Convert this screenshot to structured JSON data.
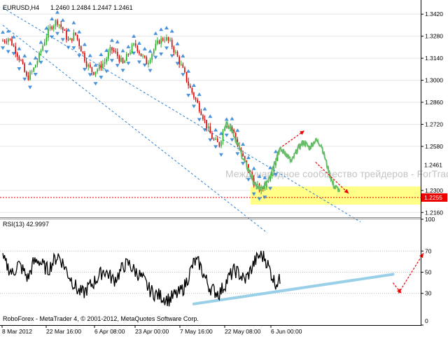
{
  "header": {
    "symbol": "EURUSD,H4",
    "ohlc": "1.2460 1.2484 1.2447 1.2461"
  },
  "watermark": "Международное сообщество трейдеров - ForTrader.ru",
  "copyright": "RoboForex - MetaTrader 4, © 2001-2012, MetaQuotes Software Corp.",
  "colors": {
    "bull_candle": "#22aa22",
    "bear_candle": "#dd0000",
    "price_line": "#66bb66",
    "channel": "#2a7fd4",
    "zone": "#ffff88",
    "arrow": "#ee0000",
    "rsi_line": "#000000",
    "rsi_trend": "#99d0e8"
  },
  "chart_data": [
    {
      "type": "candlestick",
      "name": "EURUSD,H4",
      "ylim": [
        1.213,
        1.351
      ],
      "yticks": [
        "1.3420",
        "1.3280",
        "1.3140",
        "1.3000",
        "1.2860",
        "1.2720",
        "1.2580",
        "1.2300",
        "1.2160"
      ],
      "ytick_values": [
        1.342,
        1.328,
        1.314,
        1.3,
        1.286,
        1.272,
        1.258,
        1.23,
        1.216
      ],
      "xticks": [
        "8 Mar 2012",
        "22 Mar 16:00",
        "6 Apr 08:00",
        "23 Apr 00:00",
        "7 May 16:00",
        "22 May 08:00",
        "6 Jun 00:00"
      ],
      "current_price": 1.2461,
      "current_price_label": "1.2461",
      "support_level": 1.2255,
      "support_label": "1.2255",
      "support_zone": [
        1.221,
        1.2325
      ],
      "close_path": [
        1.325,
        1.327,
        1.32,
        1.312,
        1.301,
        1.306,
        1.315,
        1.326,
        1.334,
        1.338,
        1.332,
        1.324,
        1.33,
        1.32,
        1.31,
        1.305,
        1.308,
        1.312,
        1.32,
        1.316,
        1.31,
        1.318,
        1.323,
        1.316,
        1.311,
        1.319,
        1.325,
        1.327,
        1.323,
        1.315,
        1.306,
        1.296,
        1.288,
        1.28,
        1.27,
        1.262,
        1.259,
        1.273,
        1.27,
        1.26,
        1.25,
        1.242,
        1.233,
        1.23,
        1.236,
        1.246,
        1.256,
        1.254,
        1.248,
        1.256,
        1.261,
        1.257,
        1.262,
        1.259,
        1.245,
        1.233,
        1.23
      ],
      "line_start_index": 37,
      "candle_end_index": 46,
      "fractal_offset": 0.0045,
      "channel_upper": [
        [
          0,
          1.346
        ],
        [
          56,
          1.218
        ]
      ],
      "channel_lower": [
        [
          0,
          1.335
        ],
        [
          44,
          1.203
        ]
      ],
      "arrows": [
        {
          "from": [
            51,
            1.258
          ],
          "to": [
            55,
            1.268
          ]
        },
        {
          "from": [
            57,
            1.248
          ],
          "to": [
            63,
            1.228
          ]
        }
      ]
    },
    {
      "type": "line",
      "name": "RSI(13)",
      "label": "RSI(13) 42.9997",
      "ylim": [
        0,
        100
      ],
      "yticks": [
        "100",
        "70",
        "50",
        "30",
        "0"
      ],
      "ytick_values": [
        100,
        70,
        50,
        30,
        0
      ],
      "values": [
        62,
        55,
        48,
        58,
        52,
        44,
        58,
        62,
        56,
        52,
        60,
        66,
        58,
        48,
        40,
        32,
        30,
        36,
        40,
        46,
        52,
        48,
        42,
        48,
        56,
        58,
        52,
        48,
        42,
        34,
        30,
        28,
        26,
        24,
        28,
        30,
        36,
        48,
        60,
        58,
        46,
        36,
        32,
        30,
        38,
        46,
        52,
        48,
        42,
        50,
        60,
        66,
        64,
        52,
        40,
        42
      ],
      "trendline": [
        [
          35,
          20
        ],
        [
          71,
          48
        ]
      ],
      "arrows": [
        {
          "from": [
            72,
            40
          ],
          "to": [
            73,
            30
          ]
        },
        {
          "from": [
            73,
            30
          ],
          "to": [
            77,
            68
          ]
        }
      ]
    }
  ]
}
